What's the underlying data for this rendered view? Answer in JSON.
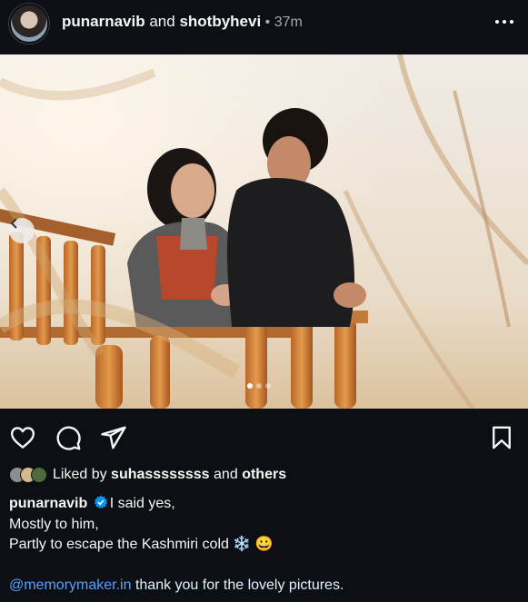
{
  "post": {
    "header": {
      "author": "punarnavib",
      "connector": " and ",
      "coauthor": "shotbyhevi",
      "separator": " • ",
      "time": "37m"
    },
    "carousel": {
      "dot_count": 3,
      "active_index": 0
    },
    "likes": {
      "prefix": "Liked by ",
      "user": "suhassssssss",
      "conjunction": " and ",
      "others": "others"
    },
    "caption": {
      "author": "punarnavib",
      "line1": "I said yes,",
      "line2": "Mostly to him,",
      "line3": "Partly to escape the Kashmiri cold",
      "emoji1": "❄️",
      "emoji2": "😀",
      "mention": "@memorymaker.in",
      "thanks": " thank you for the lovely pictures."
    }
  },
  "colors": {
    "background": "#0c1014",
    "link": "#4fa3ff",
    "verified": "#0095f6"
  }
}
